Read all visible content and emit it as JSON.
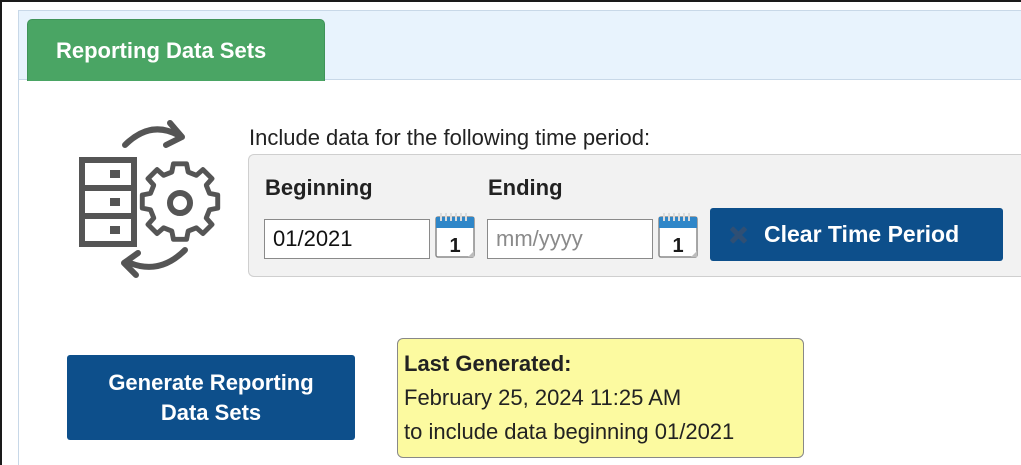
{
  "tabs": [
    {
      "label": "Reporting Data Sets",
      "active": true
    }
  ],
  "time_period": {
    "prompt": "Include data for the following time period:",
    "beginning": {
      "label": "Beginning",
      "value": "01/2021",
      "placeholder": "mm/yyyy"
    },
    "ending": {
      "label": "Ending",
      "value": "",
      "placeholder": "mm/yyyy"
    },
    "calendar_day": "1",
    "clear_label": "Clear Time Period"
  },
  "generate": {
    "label_line1": "Generate Reporting",
    "label_line2": "Data Sets"
  },
  "last_generated": {
    "heading": "Last Generated:",
    "datetime": "February 25, 2024 11:25 AM",
    "note": "to include data beginning 01/2021"
  },
  "colors": {
    "tab_green": "#4aa564",
    "tabbar_bg": "#e8f3fd",
    "button_blue": "#0d4f8b",
    "note_yellow": "#fcfaa0"
  },
  "icons": [
    "data-sync-gear-icon",
    "calendar-icon",
    "close-icon"
  ]
}
